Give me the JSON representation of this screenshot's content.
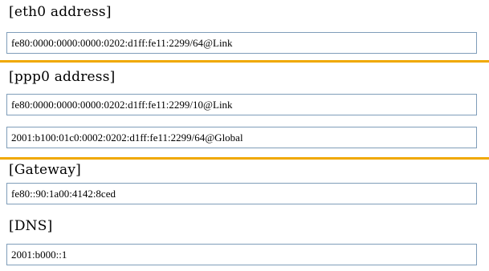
{
  "colors": {
    "highlight_line": "#f0a800",
    "field_border": "#7f9db9"
  },
  "eth0": {
    "label": "[eth0 address]",
    "value": "fe80:0000:0000:0000:0202:d1ff:fe11:2299/64@Link"
  },
  "ppp0": {
    "label": "[ppp0 address]",
    "values": [
      "fe80:0000:0000:0000:0202:d1ff:fe11:2299/10@Link",
      "2001:b100:01c0:0002:0202:d1ff:fe11:2299/64@Global"
    ]
  },
  "gateway": {
    "label": "[Gateway]",
    "value": "fe80::90:1a00:4142:8ced"
  },
  "dns": {
    "label": "[DNS]",
    "value": "2001:b000::1"
  }
}
